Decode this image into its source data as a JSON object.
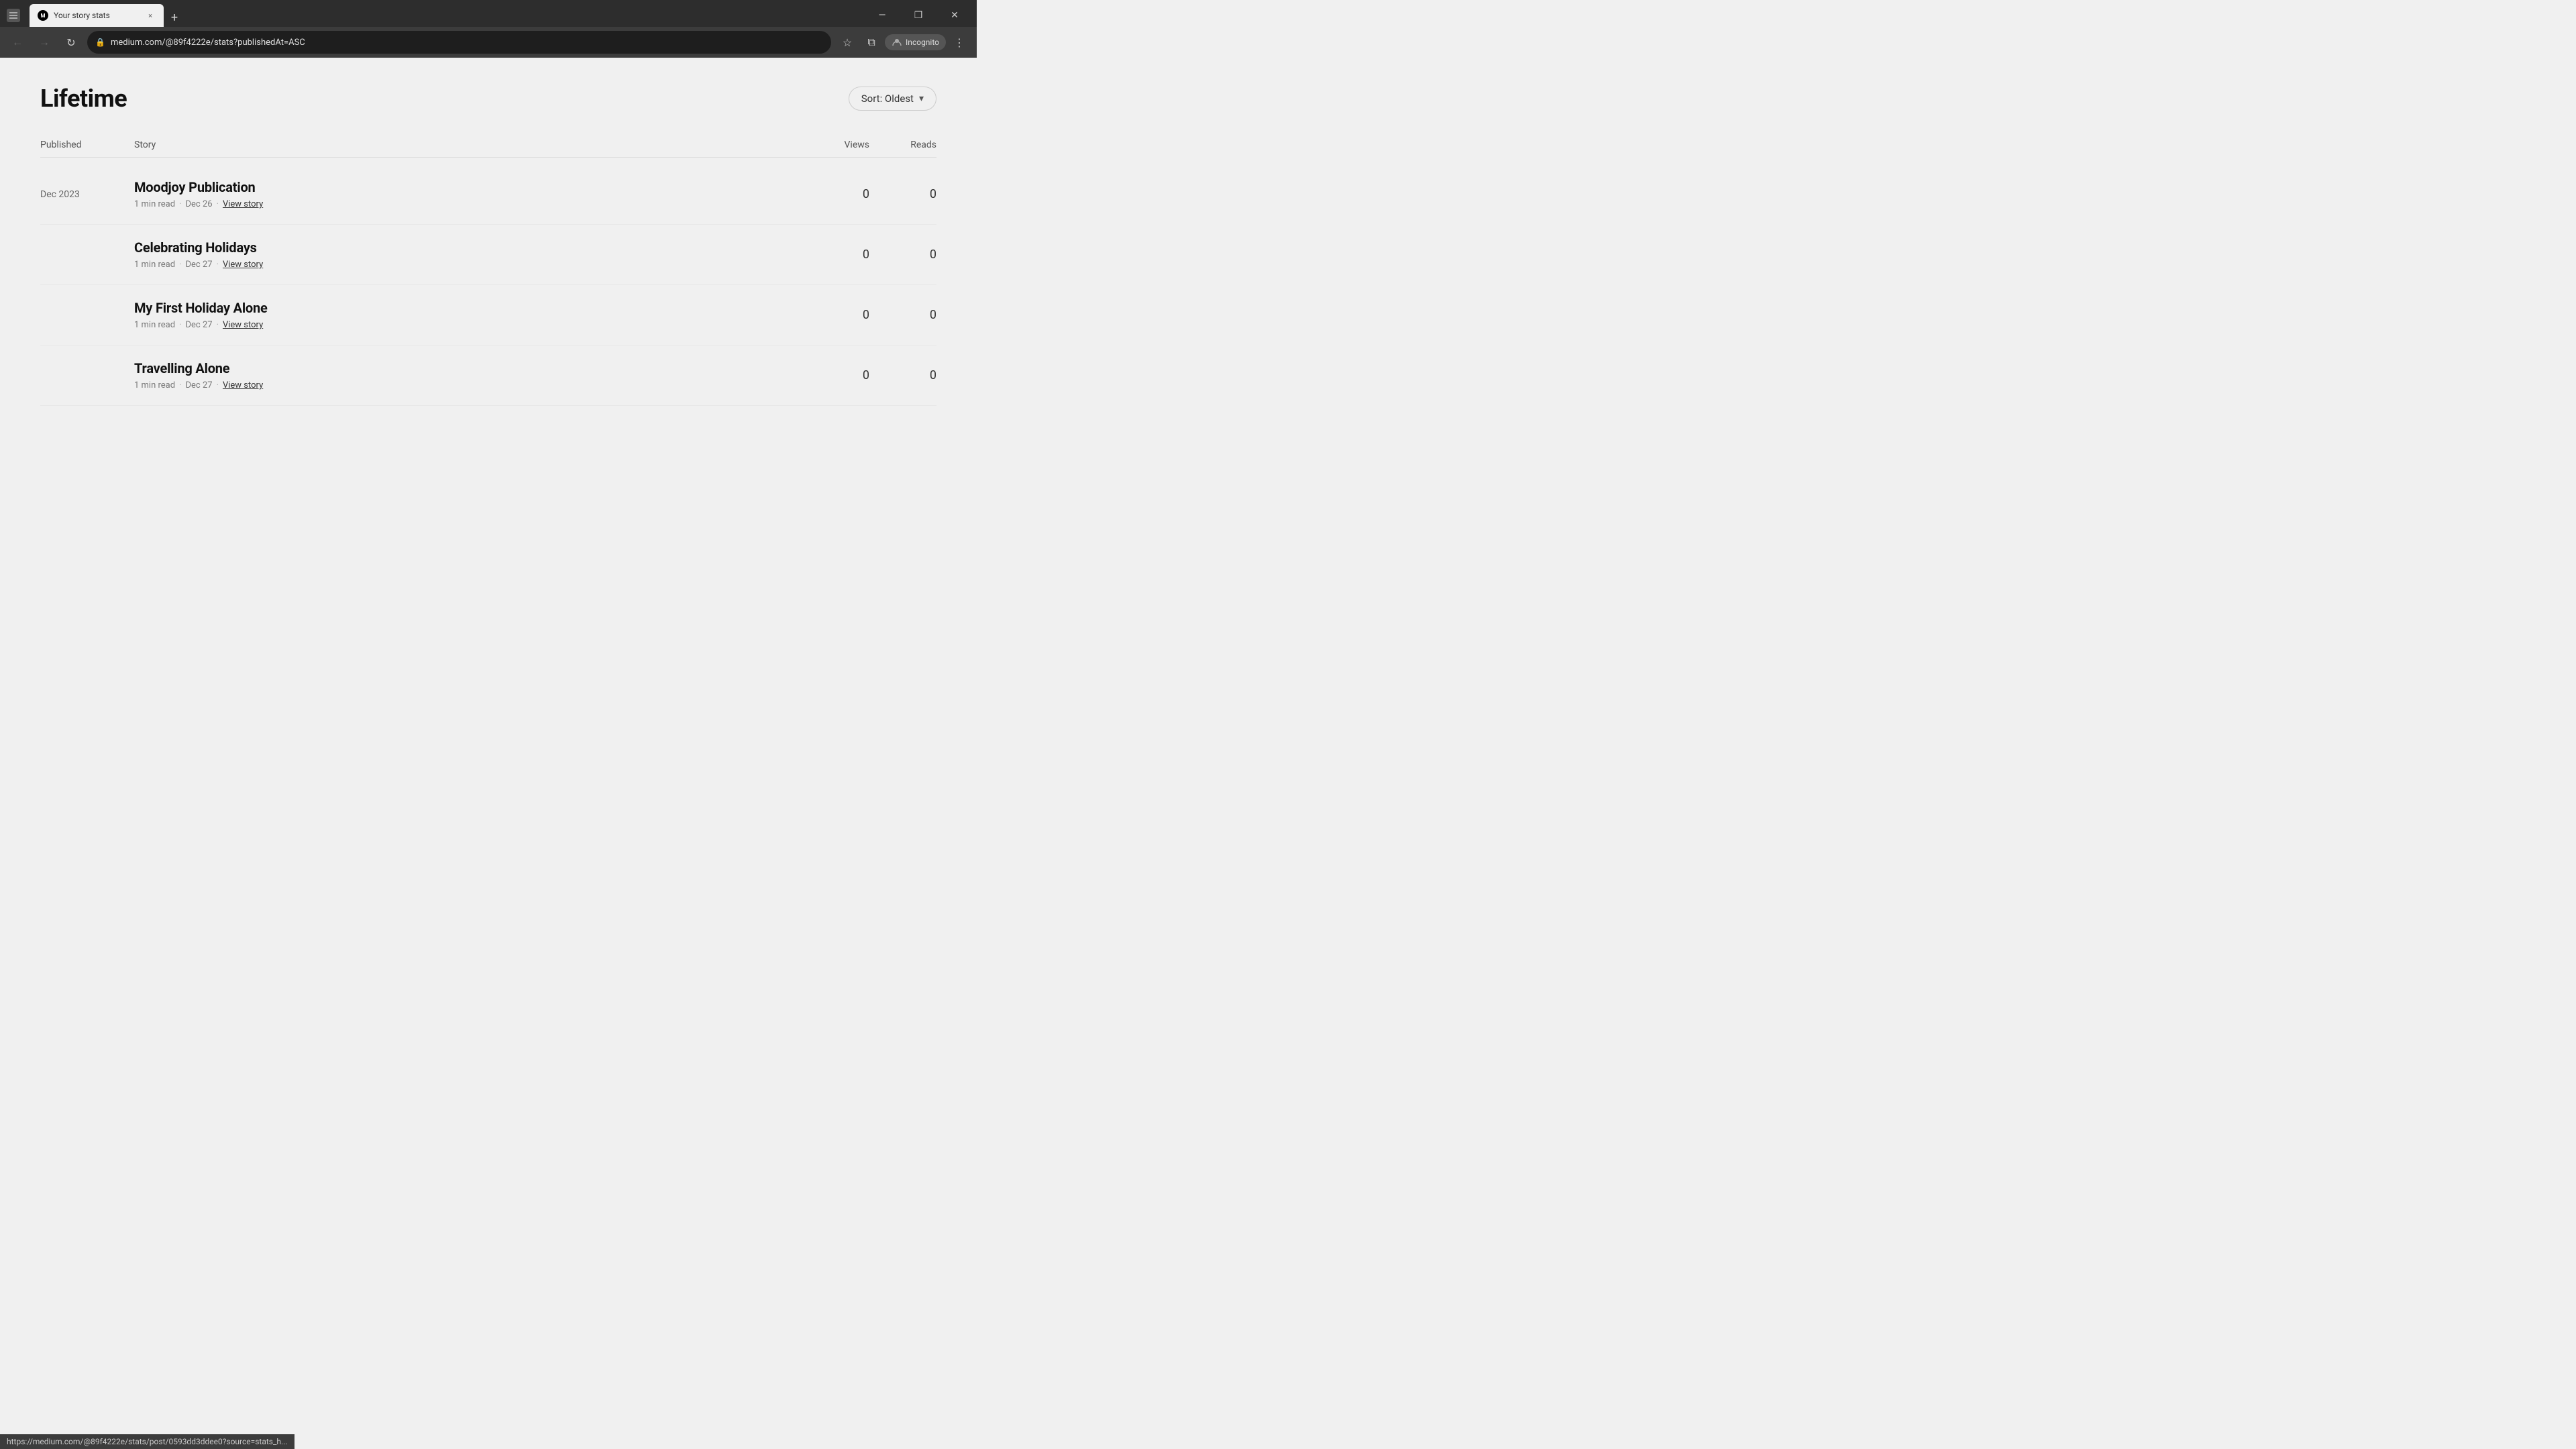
{
  "browser": {
    "tab": {
      "favicon": "M",
      "title": "Your story stats",
      "close_label": "×"
    },
    "new_tab_label": "+",
    "window_controls": {
      "minimize": "—",
      "restore": "❐",
      "close": "✕"
    },
    "nav": {
      "back": "←",
      "forward": "→",
      "refresh": "↻"
    },
    "address": "medium.com/@89f4222e/stats?publishedAt=ASC",
    "incognito_label": "Incognito",
    "more_label": "⋮",
    "bookmark_label": "☆",
    "split_label": "⧉"
  },
  "page": {
    "title": "Lifetime",
    "sort_label": "Sort: Oldest",
    "table": {
      "col_published": "Published",
      "col_story": "Story",
      "col_views": "Views",
      "col_reads": "Reads"
    },
    "stories": [
      {
        "date": "Dec 2023",
        "title": "Moodjoy Publication",
        "read_time": "1 min read",
        "publish_date": "Dec 26",
        "view_story_label": "View story",
        "views": "0",
        "reads": "0"
      },
      {
        "date": "",
        "title": "Celebrating Holidays",
        "read_time": "1 min read",
        "publish_date": "Dec 27",
        "view_story_label": "View story",
        "views": "0",
        "reads": "0"
      },
      {
        "date": "",
        "title": "My First Holiday Alone",
        "read_time": "1 min read",
        "publish_date": "Dec 27",
        "view_story_label": "View story",
        "views": "0",
        "reads": "0"
      },
      {
        "date": "",
        "title": "Travelling Alone",
        "read_time": "1 min read",
        "publish_date": "Dec 27",
        "view_story_label": "View story",
        "views": "0",
        "reads": "0"
      }
    ]
  },
  "status_bar": {
    "url": "https://medium.com/@89f4222e/stats/post/0593dd3ddee0?source=stats_h..."
  }
}
